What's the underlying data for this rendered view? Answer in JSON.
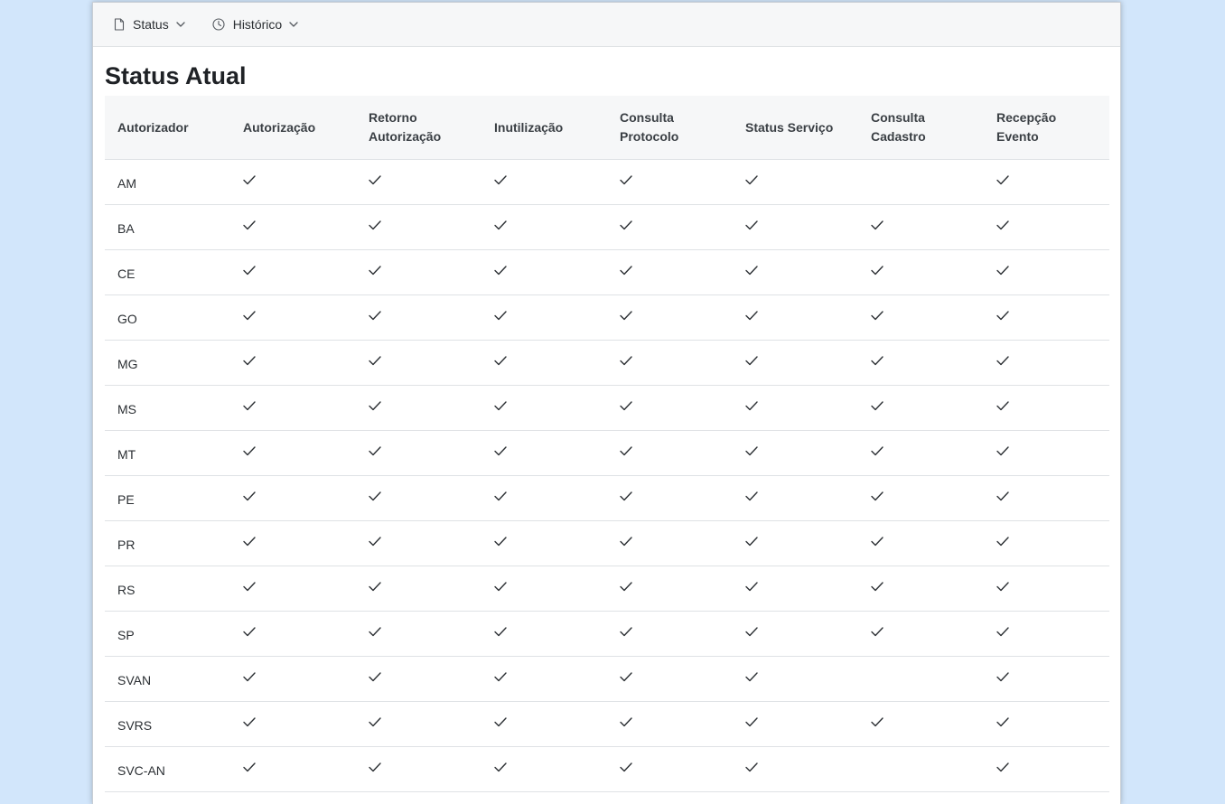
{
  "nav": {
    "status_label": "Status",
    "historico_label": "Histórico"
  },
  "page_title": "Status Atual",
  "table": {
    "columns": [
      "Autorizador",
      "Autorização",
      "Retorno Autorização",
      "Inutilização",
      "Consulta Protocolo",
      "Status Serviço",
      "Consulta Cadastro",
      "Recepção Evento"
    ],
    "rows": [
      {
        "state": "AM",
        "checks": [
          true,
          true,
          true,
          true,
          true,
          false,
          true
        ]
      },
      {
        "state": "BA",
        "checks": [
          true,
          true,
          true,
          true,
          true,
          true,
          true
        ]
      },
      {
        "state": "CE",
        "checks": [
          true,
          true,
          true,
          true,
          true,
          true,
          true
        ]
      },
      {
        "state": "GO",
        "checks": [
          true,
          true,
          true,
          true,
          true,
          true,
          true
        ]
      },
      {
        "state": "MG",
        "checks": [
          true,
          true,
          true,
          true,
          true,
          true,
          true
        ]
      },
      {
        "state": "MS",
        "checks": [
          true,
          true,
          true,
          true,
          true,
          true,
          true
        ]
      },
      {
        "state": "MT",
        "checks": [
          true,
          true,
          true,
          true,
          true,
          true,
          true
        ]
      },
      {
        "state": "PE",
        "checks": [
          true,
          true,
          true,
          true,
          true,
          true,
          true
        ]
      },
      {
        "state": "PR",
        "checks": [
          true,
          true,
          true,
          true,
          true,
          true,
          true
        ]
      },
      {
        "state": "RS",
        "checks": [
          true,
          true,
          true,
          true,
          true,
          true,
          true
        ]
      },
      {
        "state": "SP",
        "checks": [
          true,
          true,
          true,
          true,
          true,
          true,
          true
        ]
      },
      {
        "state": "SVAN",
        "checks": [
          true,
          true,
          true,
          true,
          true,
          false,
          true
        ]
      },
      {
        "state": "SVRS",
        "checks": [
          true,
          true,
          true,
          true,
          true,
          true,
          true
        ]
      },
      {
        "state": "SVC-AN",
        "checks": [
          true,
          true,
          true,
          true,
          true,
          false,
          true
        ]
      }
    ]
  },
  "icons": {
    "status_nav": "file-icon",
    "historico_nav": "clock-icon",
    "dropdown": "chevron-down-icon",
    "cell_ok": "check-icon"
  },
  "colors": {
    "background": "#d2e6fb",
    "header_bg": "#f6f7f8",
    "border": "#dfe2e5",
    "text": "#212529"
  }
}
